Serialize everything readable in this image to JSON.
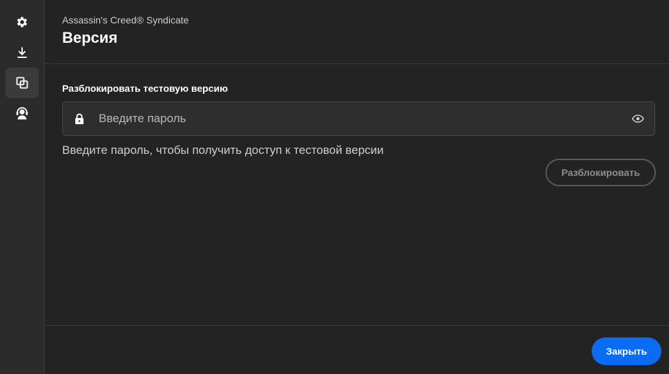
{
  "sidebar": {
    "items": [
      {
        "icon": "gear-icon",
        "active": false
      },
      {
        "icon": "download-icon",
        "active": false
      },
      {
        "icon": "versions-icon",
        "active": true
      },
      {
        "icon": "support-icon",
        "active": false
      }
    ]
  },
  "header": {
    "game_title": "Assassin's Creed® Syndicate",
    "page_title": "Версия"
  },
  "unlock": {
    "section_label": "Разблокировать тестовую версию",
    "password_placeholder": "Введите пароль",
    "password_value": "",
    "hint": "Введите пароль, чтобы получить доступ к тестовой версии",
    "unlock_label": "Разблокировать"
  },
  "footer": {
    "close_label": "Закрыть"
  },
  "colors": {
    "accent": "#0a6cf5",
    "background": "#232323",
    "sidebar": "#2a2a2a"
  }
}
